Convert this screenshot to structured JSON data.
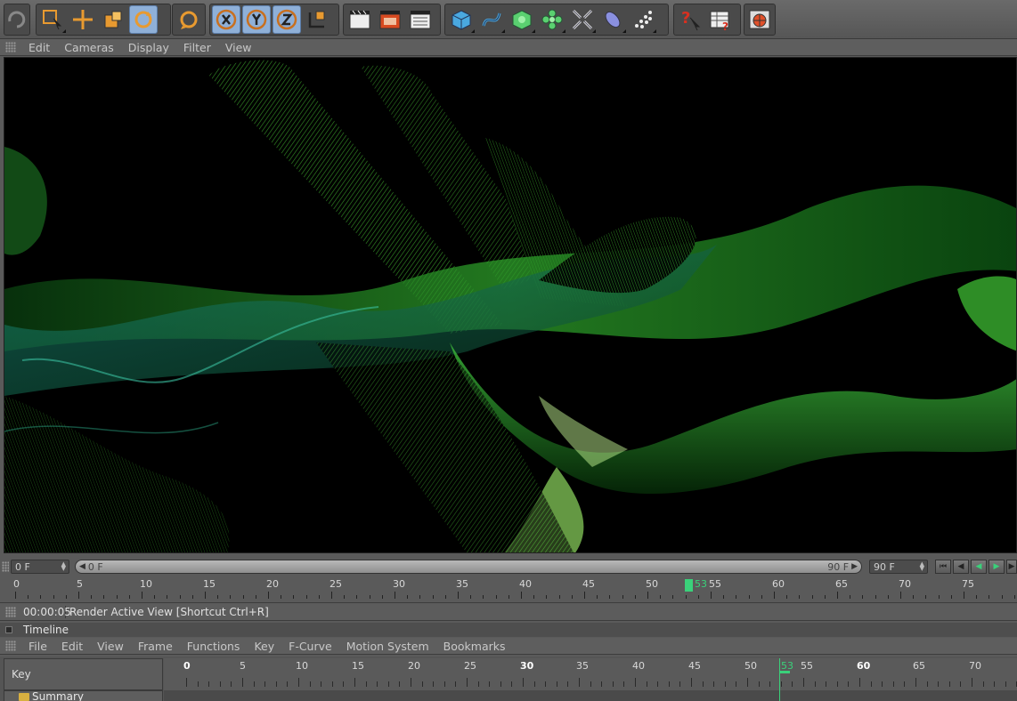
{
  "toolbar": {
    "icons": [
      "redo-icon",
      "live-selection-icon",
      "move-icon",
      "scale-icon",
      "rotate-icon",
      "rotate-alt-icon",
      "x-axis-icon",
      "y-axis-icon",
      "z-axis-icon",
      "coordinate-system-icon",
      "render-view-icon",
      "render-picture-viewer-icon",
      "render-settings-icon",
      "cube-primitive-icon",
      "spline-icon",
      "nurbs-icon",
      "array-icon",
      "deformer-icon",
      "environment-icon",
      "particles-icon",
      "help-icon",
      "table-help-icon",
      "browser-icon"
    ]
  },
  "viewport_menu": {
    "items": [
      "Edit",
      "Cameras",
      "Display",
      "Filter",
      "View"
    ]
  },
  "frame_controls": {
    "start_field": "0 F",
    "slider_left": "0 F",
    "slider_right": "90 F",
    "end_field": "90 F"
  },
  "ruler": {
    "labels": [
      "0",
      "5",
      "10",
      "15",
      "20",
      "25",
      "30",
      "35",
      "40",
      "45",
      "50",
      "55",
      "60",
      "65",
      "70",
      "75"
    ],
    "current_frame": "53"
  },
  "status": {
    "time": "00:00:05",
    "message": "Render Active View [Shortcut Ctrl+R]"
  },
  "timeline": {
    "title": "Timeline",
    "menu": [
      "File",
      "Edit",
      "View",
      "Frame",
      "Functions",
      "Key",
      "F-Curve",
      "Motion System",
      "Bookmarks"
    ],
    "key_header": "Key",
    "summary_label": "Summary",
    "ruler_labels": [
      "0",
      "5",
      "10",
      "15",
      "20",
      "25",
      "30",
      "35",
      "40",
      "45",
      "50",
      "55",
      "60",
      "65",
      "70"
    ],
    "current_frame": "53"
  },
  "colors": {
    "accent_green": "#3ad17a",
    "toggle_blue": "#8fb0d8",
    "orange_icon": "#e89a30"
  }
}
